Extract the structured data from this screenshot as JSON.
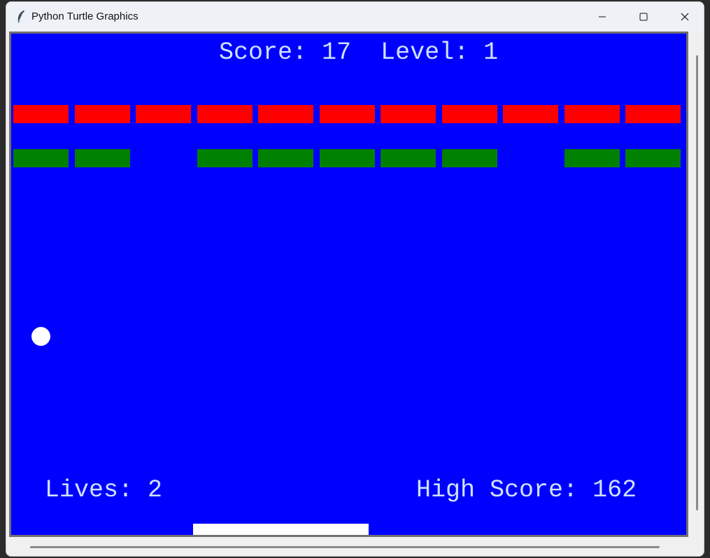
{
  "window": {
    "title": "Python Turtle Graphics",
    "icon": "feather-icon",
    "controls": [
      "minimize-icon",
      "maximize-icon",
      "close-icon"
    ]
  },
  "game": {
    "background_color": "#0000fe",
    "score_label": "Score:",
    "score": "17",
    "level_label": "Level:",
    "level": "1",
    "lives_label": "Lives:",
    "lives": "2",
    "high_score_label": "High Score:",
    "high_score": "162",
    "brick_rows": [
      {
        "color": "#ff0000",
        "present": [
          true,
          true,
          true,
          true,
          true,
          true,
          true,
          true,
          true,
          true,
          true
        ]
      },
      {
        "color": "#008000",
        "present": [
          true,
          true,
          false,
          true,
          true,
          true,
          true,
          true,
          false,
          true,
          true
        ]
      }
    ],
    "ball_color": "#ffffff",
    "paddle_color": "#ffffff"
  }
}
